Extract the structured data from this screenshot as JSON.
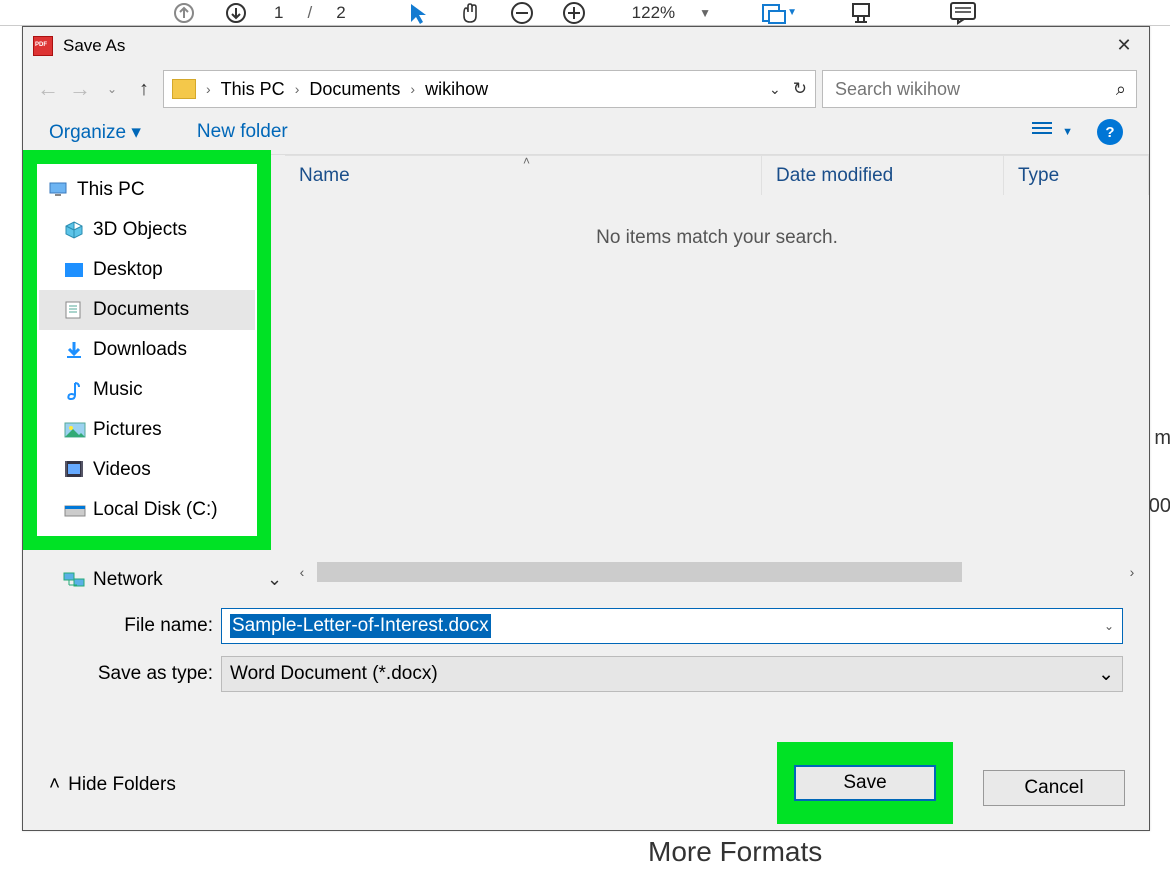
{
  "acrobat": {
    "page_current": "1",
    "page_sep": "/",
    "page_total": "2",
    "zoom": "122%"
  },
  "dialog": {
    "title": "Save As",
    "close": "✕",
    "nav": {
      "up": "↑",
      "breadcrumbs": [
        "This PC",
        "Documents",
        "wikihow"
      ],
      "refresh": "↻",
      "search_placeholder": "Search wikihow"
    },
    "toolbar": {
      "organize": "Organize ▾",
      "new_folder": "New folder",
      "help": "?"
    },
    "tree": {
      "root": "This PC",
      "items": [
        "3D Objects",
        "Desktop",
        "Documents",
        "Downloads",
        "Music",
        "Pictures",
        "Videos",
        "Local Disk (C:)"
      ],
      "selected_index": 2,
      "network": "Network"
    },
    "list": {
      "columns": {
        "name": "Name",
        "date": "Date modified",
        "type": "Type"
      },
      "empty": "No items match your search."
    },
    "form": {
      "file_name_label": "File name:",
      "file_name_value": "Sample-Letter-of-Interest.docx",
      "save_type_label": "Save as type:",
      "save_type_value": "Word Document (*.docx)"
    },
    "footer": {
      "hide_folders": "Hide Folders",
      "save": "Save",
      "cancel": "Cancel"
    }
  },
  "background": {
    "more_formats": "More Formats",
    "edge_m": "m",
    "edge_0": "00"
  }
}
